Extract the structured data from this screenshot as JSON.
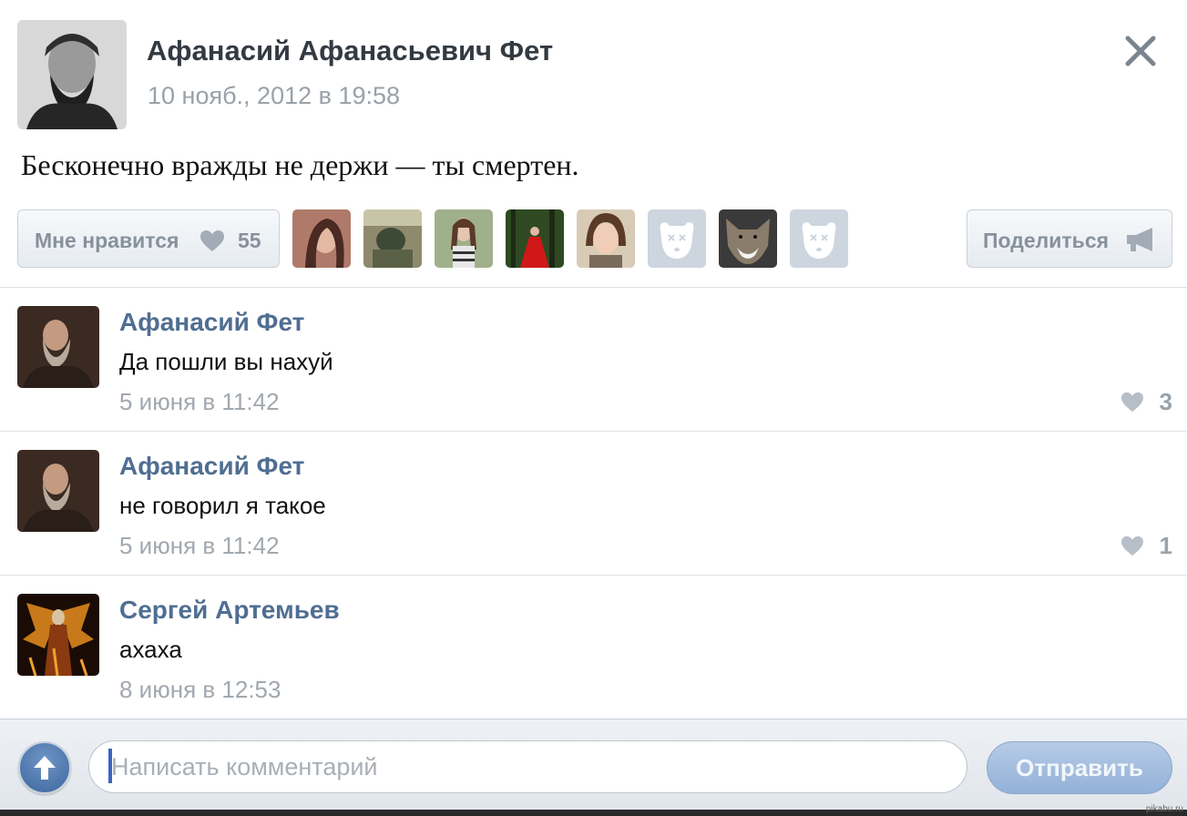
{
  "post": {
    "author": "Афанасий Афанасьевич Фет",
    "date": "10 нояб., 2012 в 19:58",
    "text": "Бесконечно вражды не держи — ты смертен.",
    "like_label": "Мне нравится",
    "like_count": "55",
    "share_label": "Поделиться",
    "likers": [
      "liker-photo",
      "liker-photo",
      "liker-photo",
      "liker-photo",
      "liker-photo",
      "deactivated-dog-icon",
      "wolf-photo",
      "deactivated-dog-icon"
    ]
  },
  "comments": [
    {
      "author": "Афанасий Фет",
      "text": "Да пошли вы нахуй",
      "date": "5 июня в 11:42",
      "likes": "3"
    },
    {
      "author": "Афанасий Фет",
      "text": "не говорил я такое",
      "date": "5 июня в 11:42",
      "likes": "1"
    },
    {
      "author": "Сергей Артемьев",
      "text": "ахаха",
      "date": "8 июня в 12:53",
      "likes": ""
    }
  ],
  "composer": {
    "placeholder": "Написать комментарий",
    "send_label": "Отправить"
  },
  "watermark": "pikabu.ru",
  "colors": {
    "link": "#4f6e92",
    "muted": "#9aa1a8",
    "send": "#93b1d8"
  }
}
